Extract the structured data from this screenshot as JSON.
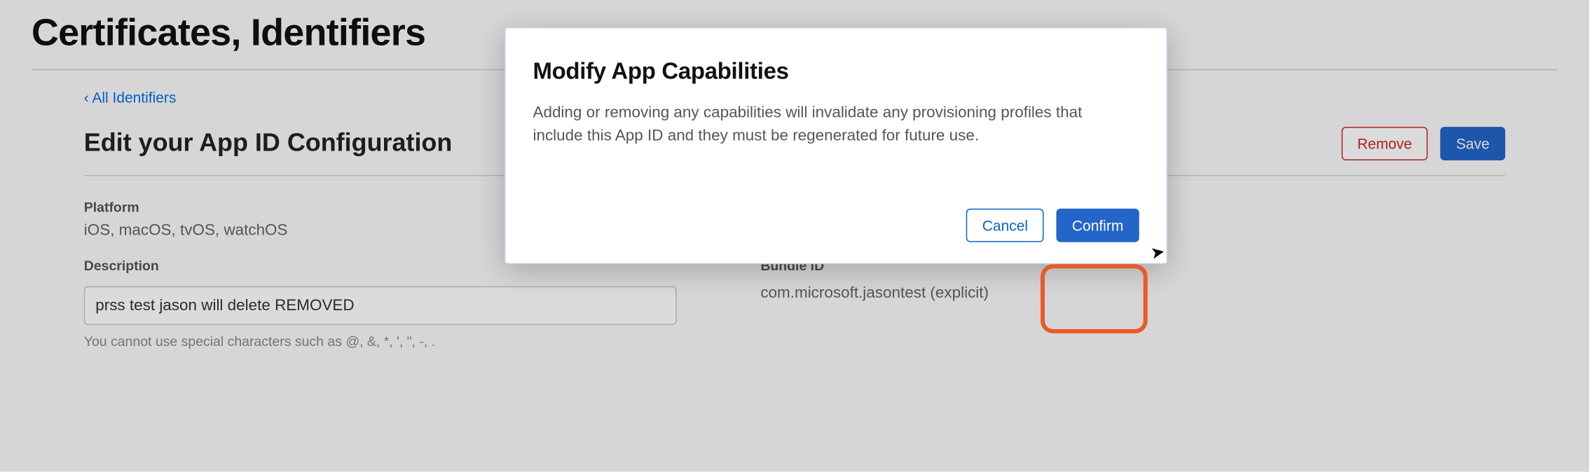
{
  "page": {
    "title": "Certificates, Identifiers",
    "back_link": "‹ All Identifiers",
    "config_title": "Edit your App ID Configuration",
    "remove_label": "Remove",
    "save_label": "Save"
  },
  "platform": {
    "label": "Platform",
    "value": "iOS, macOS, tvOS, watchOS"
  },
  "description": {
    "label": "Description",
    "value": "prss test jason will delete REMOVED",
    "help": "You cannot use special characters such as @, &, *, ', \", -, ."
  },
  "bundle": {
    "label": "Bundle ID",
    "value": "com.microsoft.jasontest (explicit)"
  },
  "modal": {
    "title": "Modify App Capabilities",
    "body": "Adding or removing any capabilities will invalidate any provisioning profiles that include this App ID and they must be regenerated for future use.",
    "cancel_label": "Cancel",
    "confirm_label": "Confirm"
  },
  "colors": {
    "accent": "#2365c8",
    "danger": "#c62828",
    "highlight": "#e85a2a"
  }
}
